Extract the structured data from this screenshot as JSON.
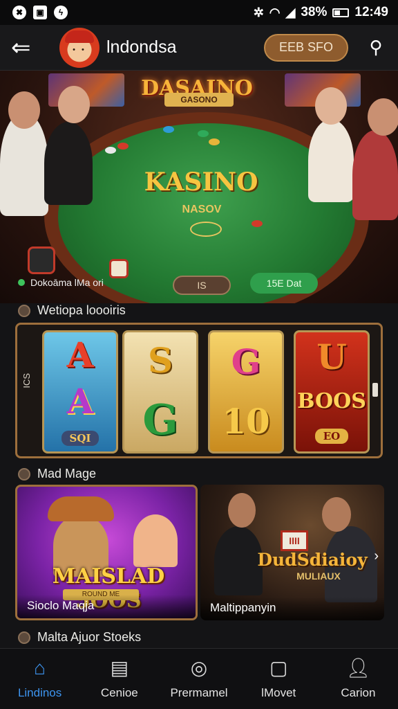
{
  "status_bar": {
    "time": "12:49",
    "battery": "38%",
    "left_icons": [
      "app-badge-icon",
      "gallery-icon",
      "messenger-icon"
    ]
  },
  "app_bar": {
    "title": "lndondsa",
    "deposit_label": "EEB SFO"
  },
  "hero": {
    "sign_title": "DASAINO",
    "sign_subtitle": "GASONO",
    "felt_title": "KASINO",
    "felt_subtitle": "NASOV",
    "footer_text": "Dokoāma lMa ori",
    "badge": "IS",
    "pill": "15E Dat"
  },
  "sections": {
    "slots_title": "Wetiopa loooiris",
    "mad_title": "Mad Mage",
    "more_title": "Malta Ajuor Stoeks"
  },
  "slots": {
    "side_label": "ICS",
    "reels": [
      {
        "top": "A",
        "bottom": "A",
        "footer": "SQI"
      },
      {
        "top": "S",
        "bottom": "G"
      },
      {
        "top": "G",
        "bottom": "10"
      },
      {
        "top": "U",
        "banner": "BOOS",
        "footer": "EO"
      }
    ]
  },
  "cards": [
    {
      "art_title": "MAISLAD 5OOS",
      "art_badge": "ROUND ME",
      "caption": "Sioclo Maqja"
    },
    {
      "art_title": "DudSdiaioy",
      "art_sub": "MULIAUX",
      "sign": "IIII",
      "caption": "Maltippanyin"
    }
  ],
  "bottom_nav": [
    {
      "label": "Lindinos",
      "icon": "home-icon",
      "active": true
    },
    {
      "label": "Cenioe",
      "icon": "document-icon",
      "active": false
    },
    {
      "label": "Prermamel",
      "icon": "target-icon",
      "active": false
    },
    {
      "label": "lMovet",
      "icon": "square-frame-icon",
      "active": false
    },
    {
      "label": "Carion",
      "icon": "person-icon",
      "active": false
    }
  ],
  "colors": {
    "accent": "#3d95f0",
    "deposit_bg": "#8e5c2e",
    "frame_gold": "#9e6f3c",
    "felt_green": "#237a32"
  }
}
